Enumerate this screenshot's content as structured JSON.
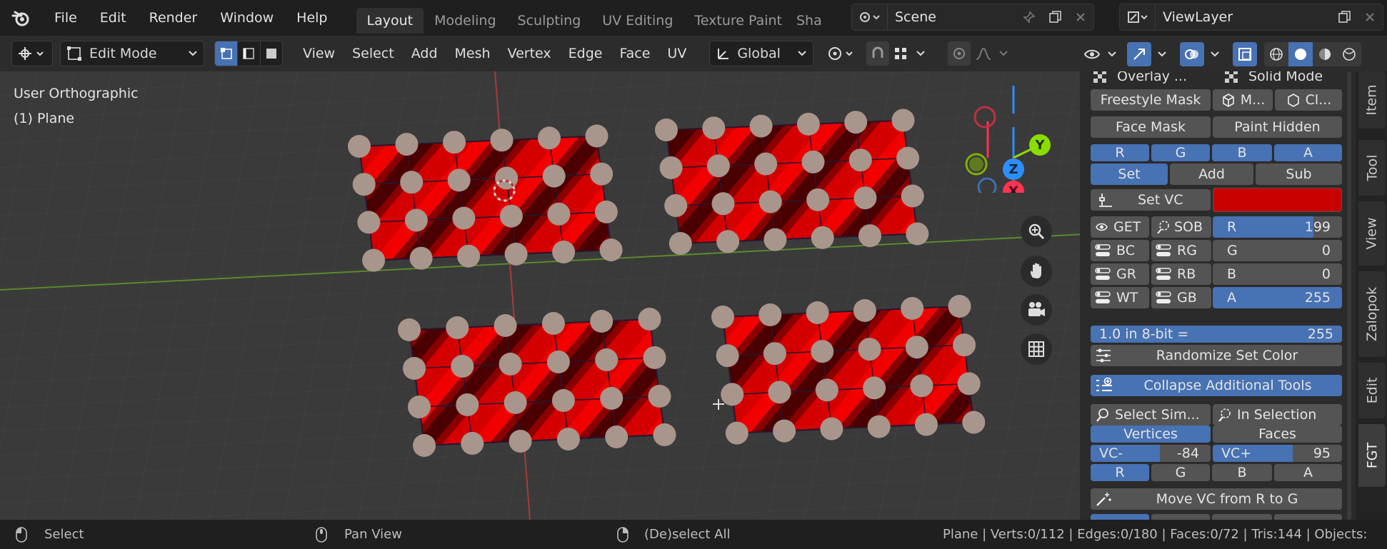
{
  "topbar": {
    "menus": [
      "File",
      "Edit",
      "Render",
      "Window",
      "Help"
    ],
    "workspaces": [
      "Layout",
      "Modeling",
      "Sculpting",
      "UV Editing",
      "Texture Paint",
      "Sha"
    ],
    "active_workspace": "Layout",
    "scene": "Scene",
    "view_layer": "ViewLayer"
  },
  "header": {
    "mode": "Edit Mode",
    "menus": [
      "View",
      "Select",
      "Add",
      "Mesh",
      "Vertex",
      "Edge",
      "Face",
      "UV"
    ],
    "transform_orientation": "Global"
  },
  "viewport": {
    "view_name": "User Orthographic",
    "object_name": "(1) Plane",
    "gizmo": {
      "z": "Z",
      "y": "Y",
      "x": "X"
    }
  },
  "panel": {
    "overlay_label": "Overlay ...",
    "solid_mode_label": "Solid Mode",
    "freestyle_mask": "Freestyle Mask",
    "m_btn": "M...",
    "cl_btn": "Cl...",
    "face_mask": "Face Mask",
    "paint_hidden": "Paint Hidden",
    "rgba": [
      "R",
      "G",
      "B",
      "A"
    ],
    "set": "Set",
    "add": "Add",
    "sub": "Sub",
    "set_vc": "Set VC",
    "color_accent": "#c80000",
    "get": "GET",
    "sob": "SOB",
    "toggles": [
      [
        "BC",
        "RG"
      ],
      [
        "GR",
        "RB"
      ],
      [
        "WT",
        "GB"
      ]
    ],
    "channels": [
      {
        "label": "R",
        "value": "199",
        "fill": 0.78
      },
      {
        "label": "G",
        "value": "0",
        "fill": 0
      },
      {
        "label": "B",
        "value": "0",
        "fill": 0
      },
      {
        "label": "A",
        "value": "255",
        "fill": 1
      }
    ],
    "in8bit_left": "1.0  in 8-bit =",
    "in8bit_right": "255",
    "randomize": "Randomize Set Color",
    "collapse": "Collapse Additional Tools",
    "select_sim": "Select Sim...",
    "in_selection": "In Selection",
    "vertices": "Vertices",
    "faces": "Faces",
    "vc_minus_label": "VC-",
    "vc_minus_value": "-84",
    "vc_plus_label": "VC+",
    "vc_plus_value": "95",
    "move_vc": "Move VC from R to G"
  },
  "sidetabs": [
    "Item",
    "Tool",
    "View",
    "Zalopok",
    "Edit",
    "FGT"
  ],
  "active_sidetab": "FGT",
  "status": {
    "select": "Select",
    "pan": "Pan View",
    "deselect": "(De)select All",
    "stats": "Plane | Verts:0/112 | Edges:0/180 | Faces:0/72 | Tris:144 | Objects:"
  }
}
